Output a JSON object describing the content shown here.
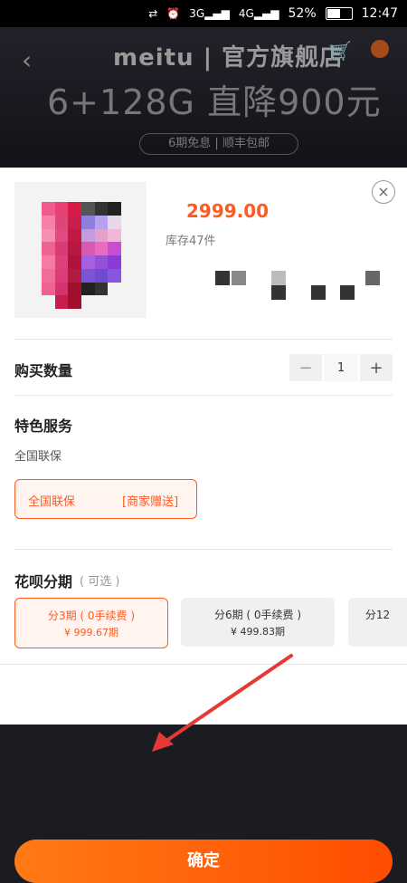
{
  "status_bar": {
    "battery": "52%",
    "time": "12:47",
    "icons": [
      "sync-off-icon",
      "alarm-icon",
      "signal-3g-icon",
      "signal-4g-icon",
      "battery-icon"
    ],
    "network_labels": [
      "3G",
      "4G"
    ]
  },
  "background_page": {
    "brand": "meitu | 官方旗舰店",
    "promo_title": "6+128G 直降900元",
    "promo_subtitle": "6期免息 | 顺丰包邮"
  },
  "sheet": {
    "price": "2999.00",
    "stock": "库存47件",
    "quantity": {
      "label": "购买数量",
      "value": "1",
      "minus": "−",
      "plus": "+"
    },
    "special_service": {
      "title": "特色服务",
      "subtitle": "全国联保",
      "chip_left": "全国联保",
      "chip_right": "[商家赠送]"
    },
    "installment": {
      "title": "花呗分期",
      "optional": "( 可选 )",
      "options": [
        {
          "line1": "分3期 ( 0手续费 )",
          "line2": "¥ 999.67期",
          "selected": true
        },
        {
          "line1": "分6期 ( 0手续费 )",
          "line2": "¥ 499.83期",
          "selected": false
        },
        {
          "line1": "分12",
          "line2": "",
          "selected": false
        }
      ]
    },
    "confirm": "确定"
  },
  "colors": {
    "accent": "#ff5a1f",
    "annotation_arrow": "#e53935"
  }
}
